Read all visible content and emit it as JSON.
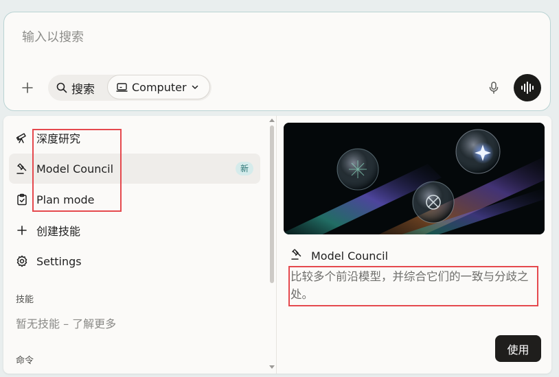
{
  "search": {
    "placeholder": "输入以搜索",
    "mode_search_label": "搜索",
    "mode_computer_label": "Computer"
  },
  "menu": {
    "items": [
      {
        "label": "深度研究",
        "icon": "telescope-icon"
      },
      {
        "label": "Model Council",
        "icon": "gavel-icon",
        "badge": "新"
      },
      {
        "label": "Plan mode",
        "icon": "clipboard-check-icon"
      },
      {
        "label": "创建技能",
        "icon": "plus-icon"
      },
      {
        "label": "Settings",
        "icon": "gear-icon"
      }
    ],
    "skills_header": "技能",
    "skills_empty": "暂无技能 – 了解更多",
    "commands_header": "命令"
  },
  "preview": {
    "title": "Model Council",
    "description": "比较多个前沿模型，并综合它们的一致与分歧之处。",
    "use_button": "使用"
  },
  "colors": {
    "accent_badge_bg": "#d5ebeb",
    "accent_badge_text": "#2d7575",
    "highlight_red": "#e5484d",
    "dark_button": "#1f1e1c"
  }
}
